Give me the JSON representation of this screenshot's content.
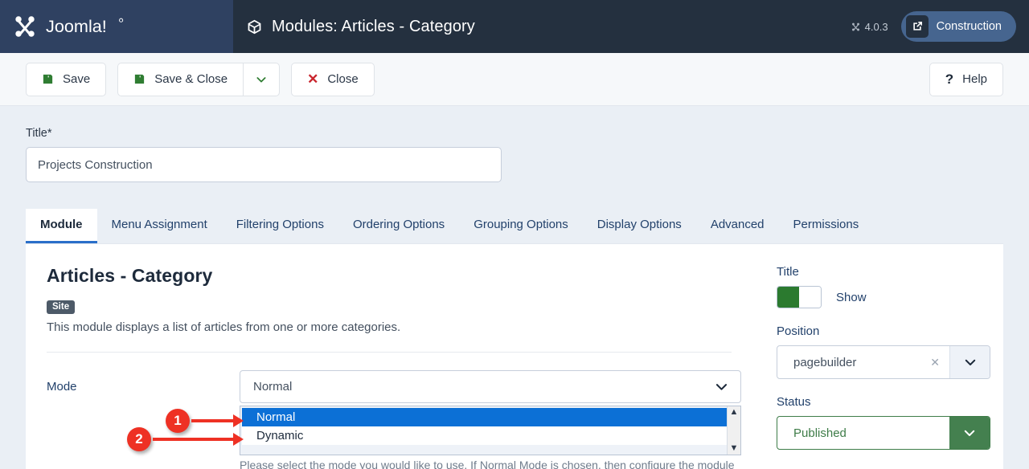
{
  "header": {
    "brand_name": "Joomla!",
    "title": "Modules: Articles - Category",
    "title_icon": "cube-icon",
    "version": "4.0.3",
    "site_button": {
      "label": "Construction",
      "icon": "external-link-icon"
    }
  },
  "toolbar": {
    "save_label": "Save",
    "save_close_label": "Save & Close",
    "close_label": "Close",
    "help_label": "Help",
    "dropdown_icon": "chevron-down-icon",
    "save_icon": "floppy-disk-icon",
    "close_icon": "x-icon",
    "help_icon": "question-mark-icon"
  },
  "form": {
    "title_label": "Title",
    "title_required_mark": "*",
    "title_value": "Projects Construction"
  },
  "tabs": [
    {
      "label": "Module",
      "active": true
    },
    {
      "label": "Menu Assignment",
      "active": false
    },
    {
      "label": "Filtering Options",
      "active": false
    },
    {
      "label": "Ordering Options",
      "active": false
    },
    {
      "label": "Grouping Options",
      "active": false
    },
    {
      "label": "Display Options",
      "active": false
    },
    {
      "label": "Advanced",
      "active": false
    },
    {
      "label": "Permissions",
      "active": false
    }
  ],
  "module": {
    "heading": "Articles - Category",
    "badge": "Site",
    "description": "This module displays a list of articles from one or more categories.",
    "mode_label": "Mode",
    "mode_selected": "Normal",
    "mode_options": [
      "Normal",
      "Dynamic"
    ],
    "mode_help": "Please select the mode you would like to use. If Normal Mode is chosen, then configure the module",
    "scroll_up_icon": "caret-up-icon",
    "scroll_down_icon": "caret-down-icon"
  },
  "sidebar": {
    "title_label": "Title",
    "title_toggle_state": "Show",
    "position_label": "Position",
    "position_value": "pagebuilder",
    "position_clear_icon": "clear-x-icon",
    "status_label": "Status",
    "status_value": "Published"
  },
  "annotations": [
    {
      "number": "1"
    },
    {
      "number": "2"
    }
  ],
  "colors": {
    "brand_dark": "#24303f",
    "brand_mid": "#2f4161",
    "accent_blue": "#2a6fc9",
    "select_blue": "#0c70d6",
    "green": "#2b7a2f",
    "red": "#ee3124"
  }
}
